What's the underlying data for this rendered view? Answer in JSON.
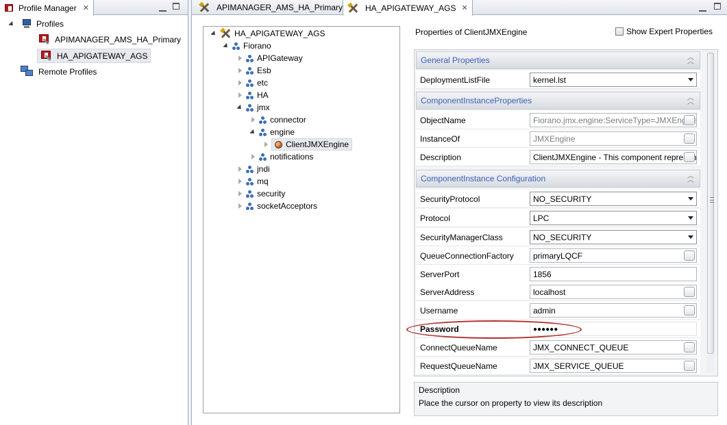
{
  "left_view": {
    "tab_label": "Profile Manager",
    "tree": {
      "profiles_label": "Profiles",
      "profile_items": [
        "APIMANAGER_AMS_HA_Primary",
        "HA_APIGATEWAY_AGS"
      ],
      "remote_label": "Remote Profiles"
    }
  },
  "editor": {
    "tabs": [
      {
        "label": "APIMANAGER_AMS_HA_Primary"
      },
      {
        "label": "HA_APIGATEWAY_AGS"
      }
    ],
    "tree": {
      "root": "HA_APIGATEWAY_AGS",
      "fiorano": "Fiorano",
      "children": [
        "APIGateway",
        "Esb",
        "etc",
        "HA",
        "jmx"
      ],
      "jmx_children": [
        "connector",
        "engine"
      ],
      "engine_child": "ClientJMXEngine",
      "jmx_after": [
        "notifications"
      ],
      "after_jmx": [
        "jndi",
        "mq",
        "security",
        "socketAcceptors"
      ]
    },
    "properties": {
      "title": "Properties of ClientJMXEngine",
      "show_expert_label": "Show Expert Properties",
      "show_expert_checked": false,
      "sections": {
        "general": {
          "label": "General Properties",
          "rows": [
            {
              "name": "DeploymentListFile",
              "value": "kernel.lst"
            }
          ]
        },
        "instance_props": {
          "label": "ComponentInstanceProperties",
          "rows": [
            {
              "name": "ObjectName",
              "value": "Fiorano.jmx.engine:ServiceType=JMXEngine"
            },
            {
              "name": "InstanceOf",
              "value": "JMXEngine"
            },
            {
              "name": "Description",
              "value": "ClientJMXEngine - This component represents"
            }
          ]
        },
        "instance_config": {
          "label": "ComponentInstance Configuration",
          "rows": [
            {
              "name": "SecurityProtocol",
              "value": "NO_SECURITY"
            },
            {
              "name": "Protocol",
              "value": "LPC"
            },
            {
              "name": "SecurityManagerClass",
              "value": "NO_SECURITY"
            },
            {
              "name": "QueueConnectionFactory",
              "value": "primaryLQCF"
            },
            {
              "name": "ServerPort",
              "value": "1856"
            },
            {
              "name": "ServerAddress",
              "value": "localhost"
            },
            {
              "name": "Username",
              "value": "admin"
            },
            {
              "name": "Password",
              "value": "●●●●●●"
            },
            {
              "name": "ConnectQueueName",
              "value": "JMX_CONNECT_QUEUE"
            },
            {
              "name": "RequestQueueName",
              "value": "JMX_SERVICE_QUEUE"
            }
          ]
        }
      },
      "description": {
        "label": "Description",
        "text": "Place the cursor on property to view its description"
      }
    }
  },
  "colors": {
    "section_header_text": "#3c60b5",
    "highlight_ellipse": "#b13232",
    "tree_node_icon": "#3d6fb6"
  }
}
